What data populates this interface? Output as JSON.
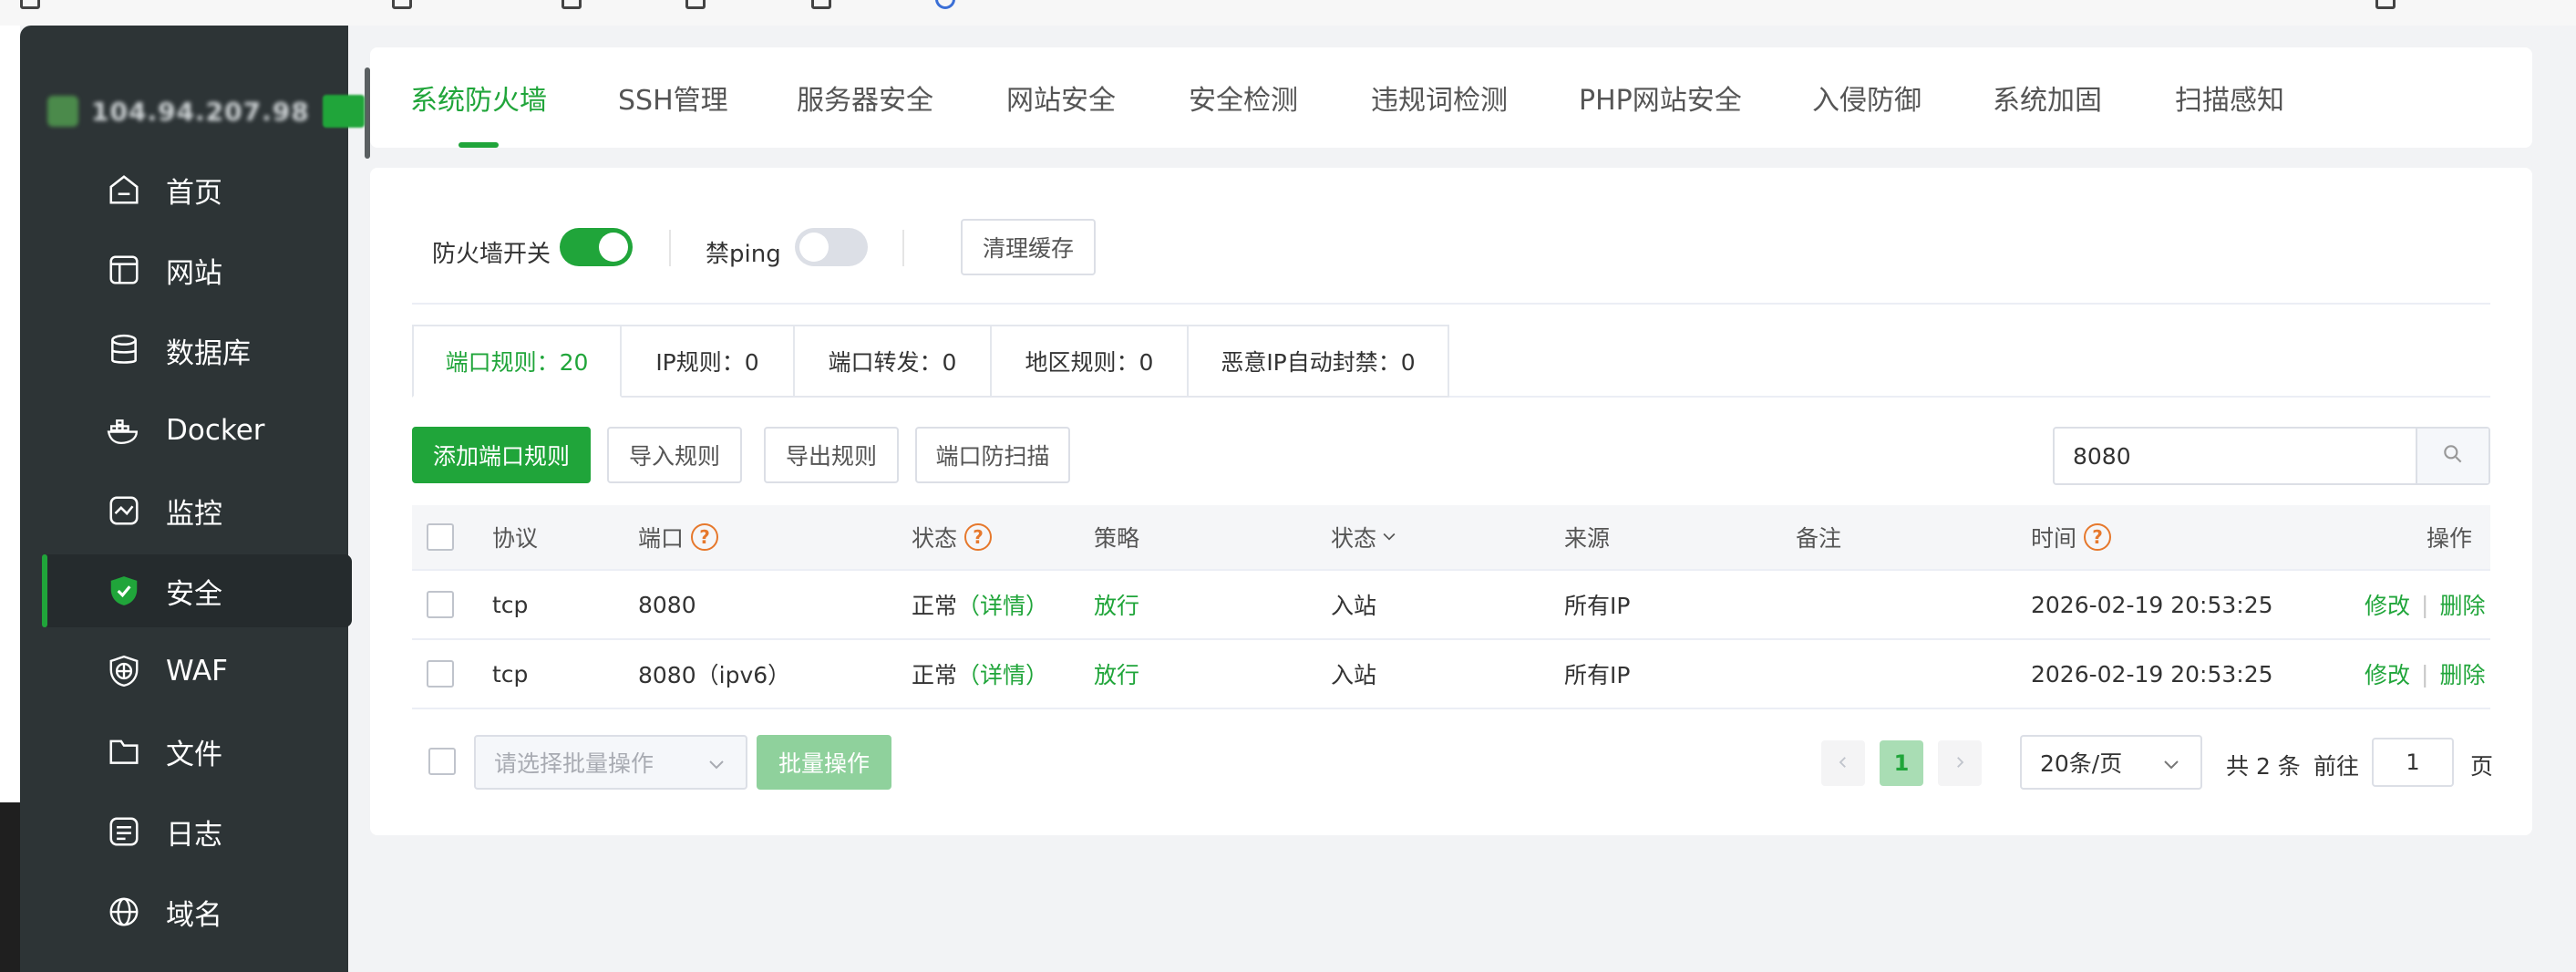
{
  "colors": {
    "accent": "#20a53a",
    "sidebar_bg": "#2d3436",
    "warning": "#e6782c"
  },
  "sidebar": {
    "server_ip": "104.94.207.98",
    "items": [
      {
        "label": "首页",
        "icon": "home-icon"
      },
      {
        "label": "网站",
        "icon": "globe-window-icon"
      },
      {
        "label": "数据库",
        "icon": "database-icon"
      },
      {
        "label": "Docker",
        "icon": "docker-icon"
      },
      {
        "label": "监控",
        "icon": "monitor-icon"
      },
      {
        "label": "安全",
        "icon": "shield-icon",
        "active": true
      },
      {
        "label": "WAF",
        "icon": "waf-icon"
      },
      {
        "label": "文件",
        "icon": "folder-icon"
      },
      {
        "label": "日志",
        "icon": "log-icon"
      },
      {
        "label": "域名",
        "icon": "www-icon"
      }
    ]
  },
  "tabs": [
    {
      "label": "系统防火墙",
      "active": true
    },
    {
      "label": "SSH管理"
    },
    {
      "label": "服务器安全"
    },
    {
      "label": "网站安全"
    },
    {
      "label": "安全检测"
    },
    {
      "label": "违规词检测"
    },
    {
      "label": "PHP网站安全"
    },
    {
      "label": "入侵防御"
    },
    {
      "label": "系统加固"
    },
    {
      "label": "扫描感知"
    }
  ],
  "toolbar": {
    "firewall_label": "防火墙开关",
    "firewall_on": true,
    "ping_label": "禁ping",
    "ping_on": false,
    "clear_cache": "清理缓存"
  },
  "rule_tabs": [
    {
      "label": "端口规则：20",
      "active": true
    },
    {
      "label": "IP规则：0"
    },
    {
      "label": "端口转发：0"
    },
    {
      "label": "地区规则：0"
    },
    {
      "label": "恶意IP自动封禁：0"
    }
  ],
  "actions": {
    "add": "添加端口规则",
    "import": "导入规则",
    "export": "导出规则",
    "anti_scan": "端口防扫描"
  },
  "search": {
    "value": "8080",
    "icon": "search-icon"
  },
  "table": {
    "headers": {
      "protocol": "协议",
      "port": "端口",
      "status": "状态",
      "policy": "策略",
      "direction": "状态",
      "source": "来源",
      "remark": "备注",
      "time": "时间",
      "ops": "操作"
    },
    "rows": [
      {
        "protocol": "tcp",
        "port": "8080",
        "status": "正常",
        "detail": "（详情）",
        "policy": "放行",
        "direction": "入站",
        "source": "所有IP",
        "remark": "",
        "time": "2026-02-19 20:53:25",
        "edit": "修改",
        "delete": "删除"
      },
      {
        "protocol": "tcp",
        "port": "8080（ipv6）",
        "status": "正常",
        "detail": "（详情）",
        "policy": "放行",
        "direction": "入站",
        "source": "所有IP",
        "remark": "",
        "time": "2026-02-19 20:53:25",
        "edit": "修改",
        "delete": "删除"
      }
    ]
  },
  "footer": {
    "batch_placeholder": "请选择批量操作",
    "batch_button": "批量操作",
    "current_page": "1",
    "page_size": "20条/页",
    "total": "共 2 条",
    "goto_label": "前往",
    "goto_value": "1",
    "page_unit": "页"
  }
}
